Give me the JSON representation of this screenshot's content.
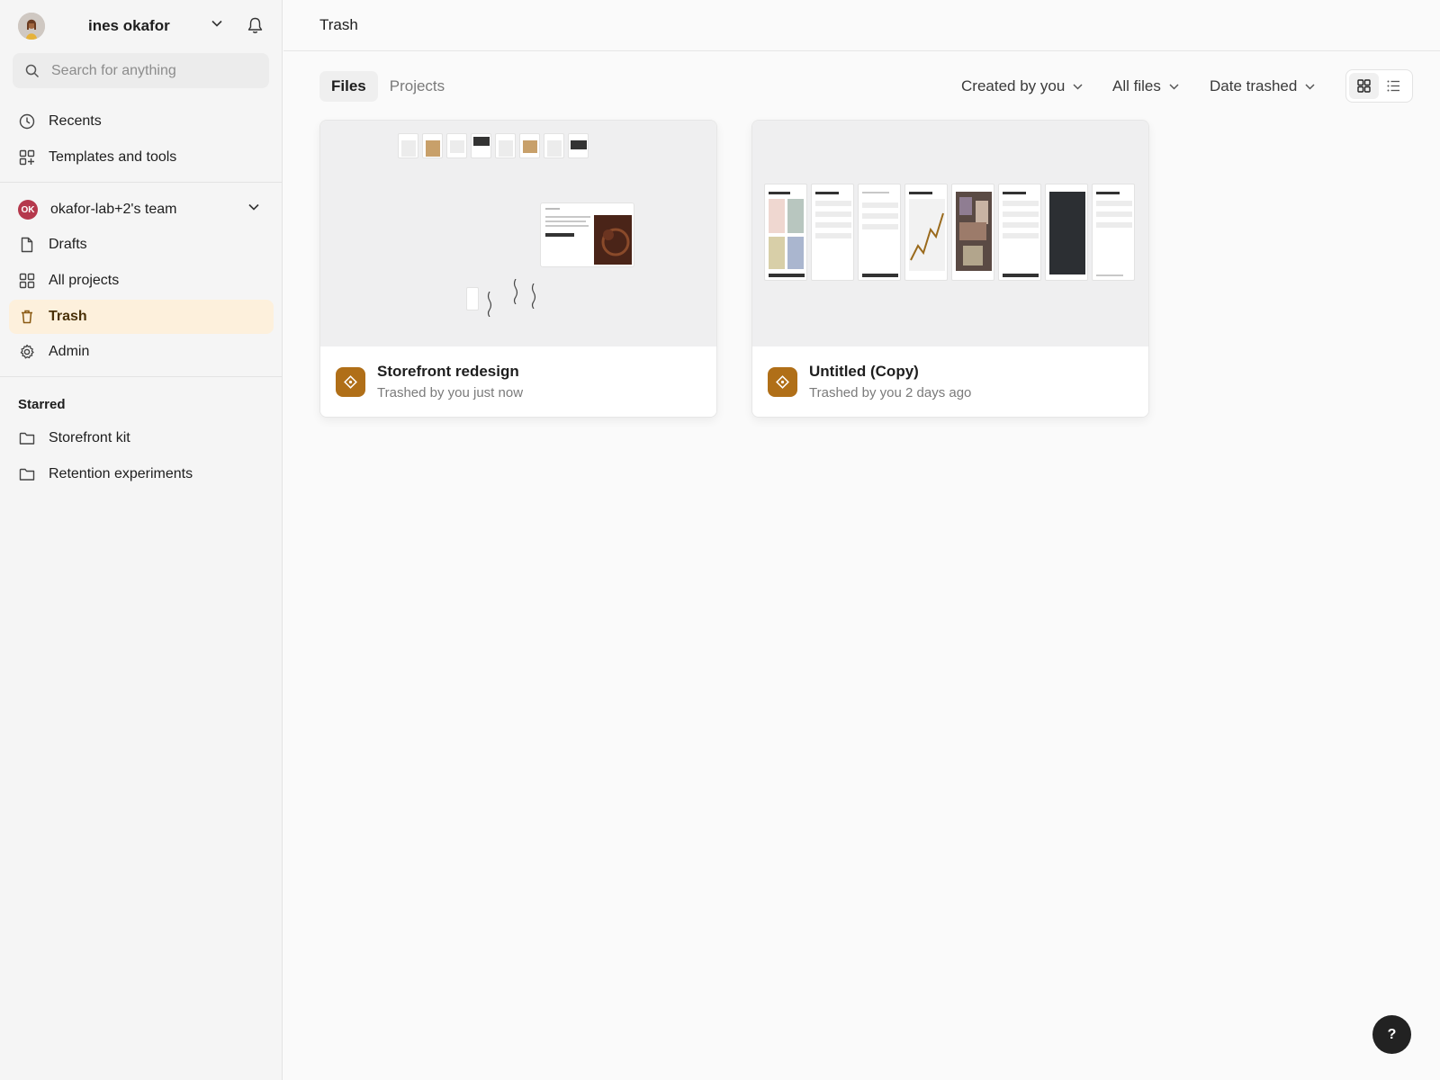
{
  "user": {
    "name": "ines okafor"
  },
  "search": {
    "placeholder": "Search for anything"
  },
  "nav": {
    "recents": "Recents",
    "templates": "Templates and tools"
  },
  "team": {
    "badge": "OK",
    "name": "okafor-lab+2's team",
    "items": {
      "drafts": "Drafts",
      "all_projects": "All projects",
      "trash": "Trash",
      "admin": "Admin"
    }
  },
  "starred": {
    "title": "Starred",
    "items": [
      "Storefront kit",
      "Retention experiments"
    ]
  },
  "page": {
    "title": "Trash"
  },
  "tabs": [
    "Files",
    "Projects"
  ],
  "active_tab": "Files",
  "filters": {
    "creator": "Created by you",
    "files": "All files",
    "sort": "Date trashed"
  },
  "view_mode": "grid",
  "files": [
    {
      "name": "Storefront redesign",
      "meta": "Trashed by you just now"
    },
    {
      "name": "Untitled (Copy)",
      "meta": "Trashed by you 2 days ago"
    }
  ],
  "help": {
    "label": "?"
  },
  "colors": {
    "accent": "#b06f18",
    "active_nav_bg": "#fdf0dc",
    "team_badge": "#b5384c"
  }
}
